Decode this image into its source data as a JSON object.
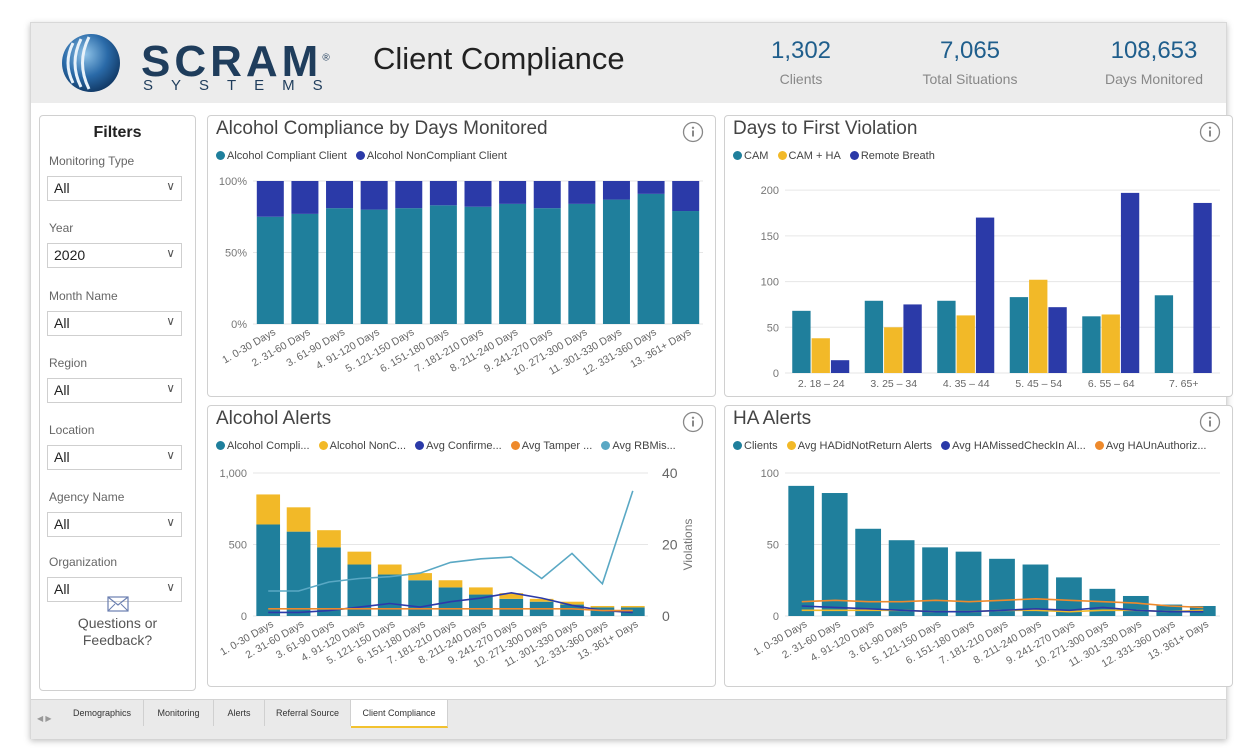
{
  "header": {
    "logo_word": "SCRAM",
    "logo_reg": "®",
    "logo_sub": "SYSTEMS",
    "title": "Client Compliance",
    "kpis": [
      {
        "value": "1,302",
        "label": "Clients"
      },
      {
        "value": "7,065",
        "label": "Total Situations"
      },
      {
        "value": "108,653",
        "label": "Days Monitored"
      }
    ]
  },
  "filters": {
    "title": "Filters",
    "items": [
      {
        "label": "Monitoring Type",
        "value": "All"
      },
      {
        "label": "Year",
        "value": "2020"
      },
      {
        "label": "Month Name",
        "value": "All"
      },
      {
        "label": "Region",
        "value": "All"
      },
      {
        "label": "Location",
        "value": "All"
      },
      {
        "label": "Agency Name",
        "value": "All"
      },
      {
        "label": "Organization",
        "value": "All"
      }
    ],
    "feedback_line1": "Questions or",
    "feedback_line2": "Feedback?"
  },
  "colors": {
    "teal": "#1f7f9c",
    "navy": "#2b3aa8",
    "yellow": "#f2b928",
    "orange": "#ee8a2c",
    "lightblue": "#5aa8c4"
  },
  "tabs": [
    "Demographics",
    "Monitoring",
    "Alerts",
    "Referral Source",
    "Client Compliance"
  ],
  "active_tab": "Client Compliance",
  "chart_data": [
    {
      "id": "compliance",
      "type": "bar",
      "stacked": "100%",
      "title": "Alcohol Compliance by Days Monitored",
      "categories": [
        "1. 0-30 Days",
        "2. 31-60 Days",
        "3. 61-90 Days",
        "4. 91-120 Days",
        "5. 121-150 Days",
        "6. 151-180 Days",
        "7. 181-210 Days",
        "8. 211-240 Days",
        "9. 241-270 Days",
        "10. 271-300 Days",
        "11. 301-330 Days",
        "12. 331-360 Days",
        "13. 361+ Days"
      ],
      "y_ticks": [
        "0%",
        "50%",
        "100%"
      ],
      "series": [
        {
          "name": "Alcohol Compliant Client",
          "color": "#1f7f9c",
          "values": [
            75,
            77,
            81,
            80,
            81,
            83,
            82,
            84,
            81,
            84,
            87,
            91,
            79
          ]
        },
        {
          "name": "Alcohol NonCompliant Client",
          "color": "#2b3aa8",
          "values": [
            25,
            23,
            19,
            20,
            19,
            17,
            18,
            16,
            19,
            16,
            13,
            9,
            21
          ]
        }
      ],
      "ylim": [
        0,
        100
      ]
    },
    {
      "id": "first_violation",
      "type": "bar",
      "title": "Days to First Violation",
      "categories": [
        "2. 18 – 24",
        "3. 25 – 34",
        "4. 35 – 44",
        "5. 45 – 54",
        "6. 55 – 64",
        "7. 65+"
      ],
      "y_ticks": [
        "0",
        "50",
        "100",
        "150",
        "200"
      ],
      "series": [
        {
          "name": "CAM",
          "color": "#1f7f9c",
          "values": [
            68,
            79,
            79,
            83,
            62,
            85
          ]
        },
        {
          "name": "CAM + HA",
          "color": "#f2b928",
          "values": [
            38,
            50,
            63,
            102,
            64,
            0
          ]
        },
        {
          "name": "Remote Breath",
          "color": "#2b3aa8",
          "values": [
            14,
            75,
            170,
            72,
            197,
            186
          ]
        }
      ],
      "ylim": [
        0,
        210
      ]
    },
    {
      "id": "alcohol_alerts",
      "type": "bar",
      "title": "Alcohol Alerts",
      "categories": [
        "1. 0-30 Days",
        "2. 31-60 Days",
        "3. 61-90 Days",
        "4. 91-120 Days",
        "5. 121-150 Days",
        "6. 151-180 Days",
        "7. 181-210 Days",
        "8. 211-240 Days",
        "9. 241-270 Days",
        "10. 271-300 Days",
        "11. 301-330 Days",
        "12. 331-360 Days",
        "13. 361+ Days"
      ],
      "y_ticks": [
        "0",
        "500",
        "1,000"
      ],
      "y2_ticks": [
        "0",
        "20",
        "40"
      ],
      "y2label": "Violations",
      "series": [
        {
          "name": "Alcohol Compli...",
          "color": "#1f7f9c",
          "type": "bar",
          "values": [
            640,
            590,
            480,
            360,
            290,
            250,
            200,
            150,
            120,
            100,
            80,
            60,
            60
          ]
        },
        {
          "name": "Alcohol NonC...",
          "color": "#f2b928",
          "type": "bar",
          "values": [
            210,
            170,
            120,
            90,
            70,
            50,
            50,
            50,
            40,
            20,
            20,
            10,
            10
          ]
        },
        {
          "name": "Avg Confirme...",
          "color": "#2b3aa8",
          "type": "line",
          "axis": "y2",
          "values": [
            1,
            1,
            1.5,
            2.5,
            3.5,
            2.5,
            4,
            5,
            6.5,
            5,
            3,
            1.5,
            1
          ]
        },
        {
          "name": "Avg Tamper ...",
          "color": "#ee8a2c",
          "type": "line",
          "axis": "y2",
          "values": [
            2,
            2,
            2,
            2,
            2,
            2,
            2,
            2,
            2,
            2,
            2,
            1.5,
            1.5
          ]
        },
        {
          "name": "Avg RBMis...",
          "color": "#5aa8c4",
          "type": "line",
          "axis": "y2",
          "values": [
            7,
            7,
            9.5,
            10.5,
            11,
            12,
            15,
            16,
            16.5,
            10.5,
            17.5,
            9,
            35
          ]
        }
      ],
      "ylim": [
        0,
        1000
      ],
      "y2lim": [
        0,
        40
      ]
    },
    {
      "id": "ha_alerts",
      "type": "bar",
      "title": "HA Alerts",
      "categories": [
        "1. 0-30 Days",
        "2. 31-60 Days",
        "4. 91-120 Days",
        "3. 61-90 Days",
        "5. 121-150 Days",
        "6. 151-180 Days",
        "7. 181-210 Days",
        "8. 211-240 Days",
        "9. 241-270 Days",
        "10. 271-300 Days",
        "11. 301-330 Days",
        "12. 331-360 Days",
        "13. 361+ Days"
      ],
      "y_ticks": [
        "0",
        "50",
        "100"
      ],
      "series": [
        {
          "name": "Clients",
          "color": "#1f7f9c",
          "type": "bar",
          "values": [
            91,
            86,
            61,
            53,
            48,
            45,
            40,
            36,
            27,
            19,
            14,
            8,
            7
          ]
        },
        {
          "name": "Avg HADidNotReturn Alerts",
          "color": "#f2b928",
          "type": "line",
          "values": [
            4,
            4,
            4,
            4,
            3,
            3,
            4,
            4,
            3,
            4,
            4,
            3,
            4
          ]
        },
        {
          "name": "Avg HAMissedCheckIn Al...",
          "color": "#2b3aa8",
          "type": "line",
          "values": [
            7,
            6,
            5,
            4,
            3,
            3,
            4,
            5,
            4,
            6,
            4,
            3,
            3
          ]
        },
        {
          "name": "Avg HAUnAuthoriz...",
          "color": "#ee8a2c",
          "type": "line",
          "values": [
            10,
            11,
            10,
            10,
            11,
            10,
            11,
            12,
            11,
            10,
            9,
            7,
            6
          ]
        }
      ],
      "ylim": [
        0,
        100
      ]
    }
  ]
}
